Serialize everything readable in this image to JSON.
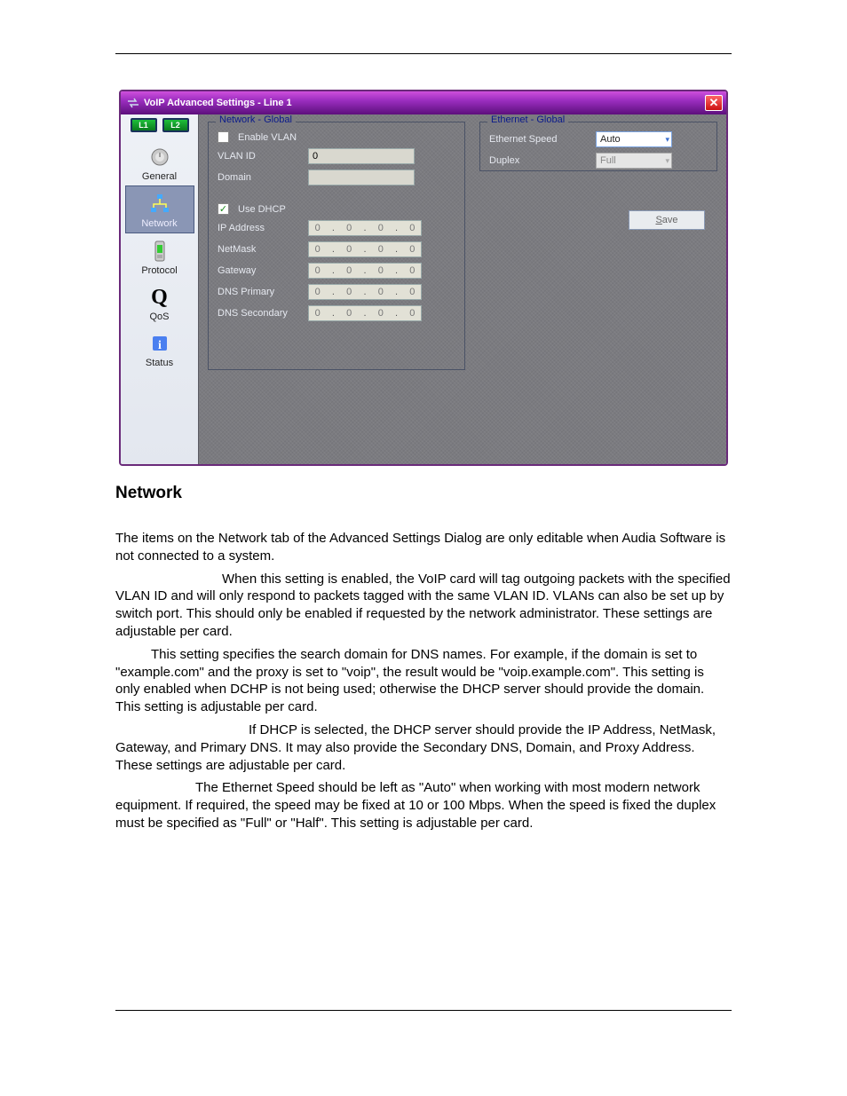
{
  "dialog": {
    "title": "VoIP Advanced Settings - Line 1",
    "line_tabs": [
      "L1",
      "L2"
    ],
    "nav": [
      {
        "id": "general",
        "label": "General"
      },
      {
        "id": "network",
        "label": "Network"
      },
      {
        "id": "protocol",
        "label": "Protocol"
      },
      {
        "id": "qos",
        "label": "QoS"
      },
      {
        "id": "status",
        "label": "Status"
      }
    ],
    "network_group": {
      "legend": "Network - Global",
      "enable_vlan_label": "Enable VLAN",
      "enable_vlan_checked": false,
      "vlan_id_label": "VLAN ID",
      "vlan_id_value": "0",
      "domain_label": "Domain",
      "domain_value": "",
      "use_dhcp_label": "Use DHCP",
      "use_dhcp_checked": true,
      "ip_addr_label": "IP Address",
      "netmask_label": "NetMask",
      "gateway_label": "Gateway",
      "dns1_label": "DNS Primary",
      "dns2_label": "DNS Secondary",
      "ip_placeholder": [
        "0",
        "0",
        "0",
        "0"
      ]
    },
    "ethernet_group": {
      "legend": "Ethernet - Global",
      "speed_label": "Ethernet Speed",
      "speed_value": "Auto",
      "duplex_label": "Duplex",
      "duplex_value": "Full"
    },
    "save_label": "Save"
  },
  "doc": {
    "heading": "Network",
    "p1": "The items on the Network tab of the Advanced Settings Dialog are only editable when Audia Software is not connected to a system.",
    "p2": "When this setting is enabled, the VoIP card will tag outgoing packets with the specified VLAN ID and will only respond to packets tagged with the same VLAN ID.  VLANs can also be set up by switch port.  This should only be enabled if requested by the network administrator.  These settings are adjustable per card.",
    "p3": "This setting specifies the search domain for DNS names.  For example, if the domain is set to \"example.com\" and the proxy is set to \"voip\", the result would be \"voip.example.com\".  This setting is only enabled when DCHP is not being used; otherwise the DHCP server should provide the domain.  This setting is adjustable per card.",
    "p4": "If DHCP is selected, the DHCP server should provide the IP Address, NetMask, Gateway, and Primary DNS.  It may also provide the Secondary DNS, Domain, and Proxy Address.  These settings are adjustable per card.",
    "p5": "The Ethernet Speed should be left as \"Auto\" when working with most modern network equipment.  If required, the speed may be fixed at 10 or 100 Mbps.  When the speed is fixed the duplex must be specified as \"Full\" or \"Half\".  This setting is adjustable per card."
  }
}
